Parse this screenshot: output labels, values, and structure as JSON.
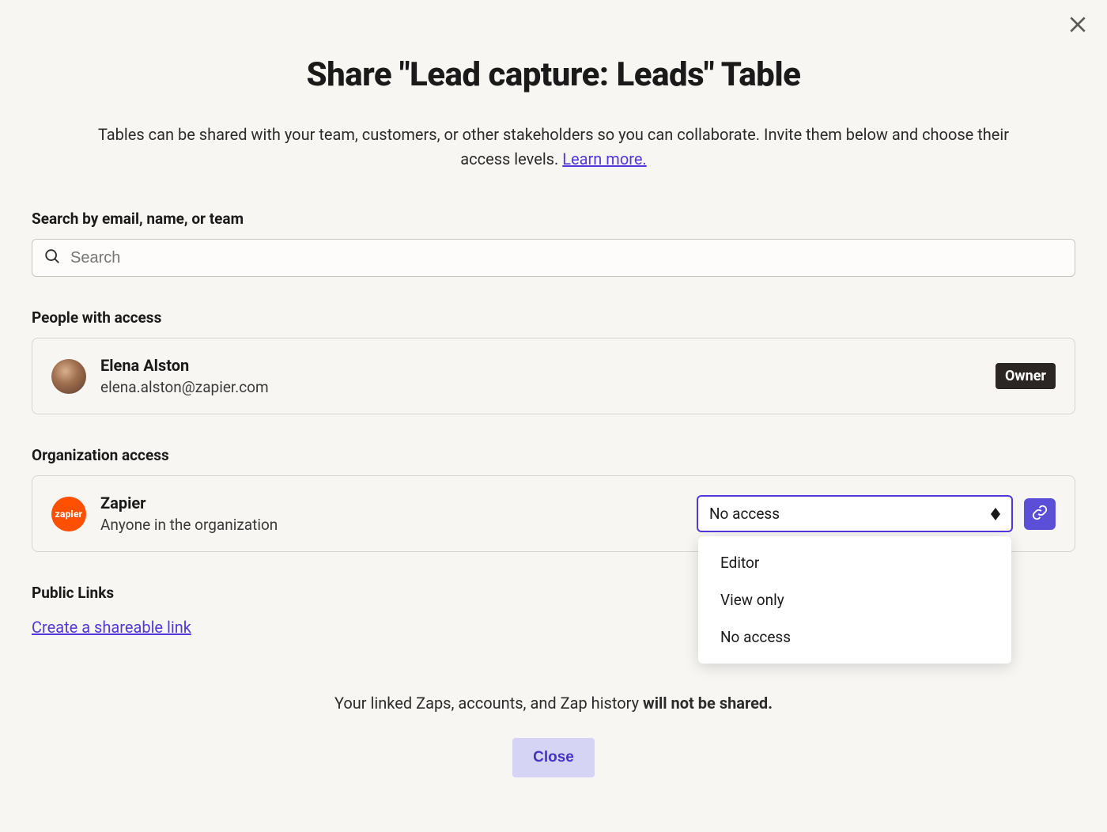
{
  "dialog": {
    "title": "Share \"Lead capture: Leads\" Table",
    "subtitle_prefix": "Tables can be shared with your team, customers, or other stakeholders so you can collaborate. Invite them below and choose their access levels. ",
    "learn_more": "Learn more."
  },
  "search": {
    "label": "Search by email, name, or team",
    "placeholder": "Search"
  },
  "people": {
    "heading": "People with access",
    "items": [
      {
        "name": "Elena Alston",
        "email": "elena.alston@zapier.com",
        "role": "Owner"
      }
    ]
  },
  "org": {
    "heading": "Organization access",
    "name": "Zapier",
    "desc": "Anyone in the organization",
    "avatar_text": "zapier",
    "selected": "No access",
    "options": [
      "Editor",
      "View only",
      "No access"
    ]
  },
  "public": {
    "heading": "Public Links",
    "create_link": "Create a shareable link"
  },
  "footer": {
    "note_prefix": "Your linked Zaps, accounts, and Zap history ",
    "note_bold": "will not be shared.",
    "close_label": "Close"
  }
}
